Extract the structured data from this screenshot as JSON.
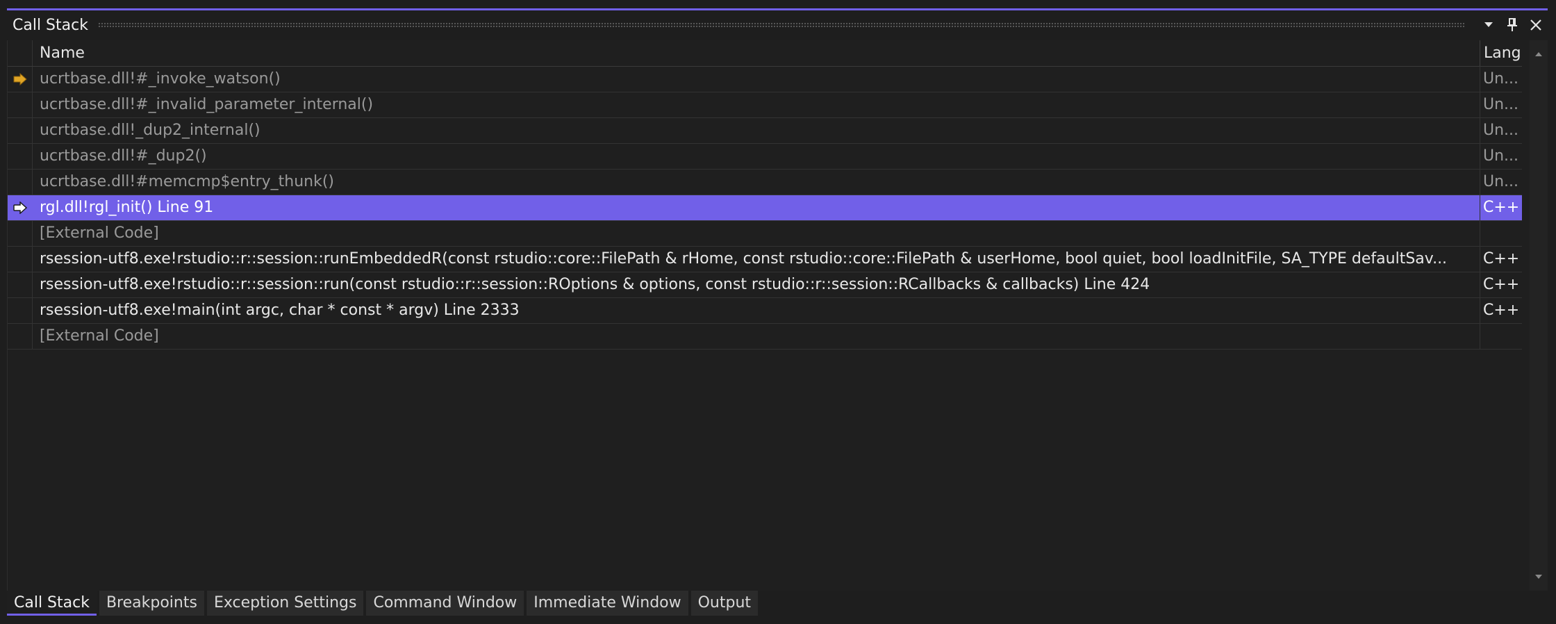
{
  "window": {
    "title": "Call Stack",
    "accent_color": "#7160e8",
    "buttons": {
      "dropdown": "▼",
      "pin": "📌",
      "close": "✕"
    }
  },
  "columns": {
    "name": "Name",
    "language": "Lang"
  },
  "rows": [
    {
      "name": "ucrtbase.dll!#_invoke_watson()",
      "language": "Un...",
      "style": "dim",
      "marker": "current"
    },
    {
      "name": "ucrtbase.dll!#_invalid_parameter_internal()",
      "language": "Un...",
      "style": "dim",
      "marker": ""
    },
    {
      "name": "ucrtbase.dll!_dup2_internal()",
      "language": "Un...",
      "style": "dim",
      "marker": ""
    },
    {
      "name": "ucrtbase.dll!#_dup2()",
      "language": "Un...",
      "style": "dim",
      "marker": ""
    },
    {
      "name": "ucrtbase.dll!#memcmp$entry_thunk()",
      "language": "Un...",
      "style": "dim",
      "marker": ""
    },
    {
      "name": "rgl.dll!rgl_init() Line 91",
      "language": "C++",
      "style": "sel",
      "marker": "caller"
    },
    {
      "name": "[External Code]",
      "language": "",
      "style": "dim",
      "marker": ""
    },
    {
      "name": "rsession-utf8.exe!rstudio::r::session::runEmbeddedR(const rstudio::core::FilePath & rHome, const rstudio::core::FilePath & userHome, bool quiet, bool loadInitFile, SA_TYPE defaultSav...",
      "language": "C++",
      "style": "normal",
      "marker": ""
    },
    {
      "name": "rsession-utf8.exe!rstudio::r::session::run(const rstudio::r::session::ROptions & options, const rstudio::r::session::RCallbacks & callbacks) Line 424",
      "language": "C++",
      "style": "normal",
      "marker": ""
    },
    {
      "name": "rsession-utf8.exe!main(int argc, char * const * argv) Line 2333",
      "language": "C++",
      "style": "normal",
      "marker": ""
    },
    {
      "name": "[External Code]",
      "language": "",
      "style": "dim",
      "marker": ""
    }
  ],
  "tabs": [
    {
      "label": "Call Stack",
      "active": true
    },
    {
      "label": "Breakpoints",
      "active": false
    },
    {
      "label": "Exception Settings",
      "active": false
    },
    {
      "label": "Command Window",
      "active": false
    },
    {
      "label": "Immediate Window",
      "active": false
    },
    {
      "label": "Output",
      "active": false
    }
  ]
}
